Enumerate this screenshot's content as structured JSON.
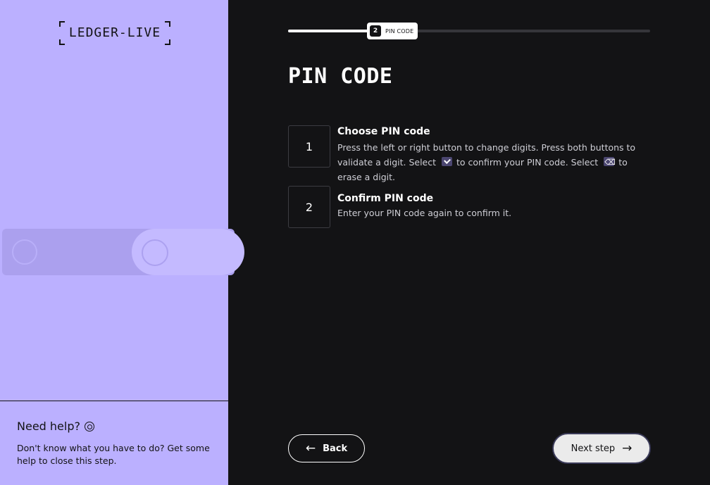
{
  "left_panel": {
    "logo_text": "LEDGER-LIVE",
    "help": {
      "title": "Need help?",
      "icon": "lifebuoy-icon",
      "text": "Don't know what you have to do? Get some help to close this step."
    },
    "background_color": "#bbb0ff"
  },
  "progress": {
    "current_step_number": "2",
    "current_step_label": "PIN CODE",
    "fill_fraction": 0.23
  },
  "main": {
    "title": "PIN CODE",
    "steps": [
      {
        "number": "1",
        "title": "Choose PIN code",
        "desc_part1": "Press the left or right button to change digits. Press both buttons to validate a digit. Select",
        "desc_part2": "to confirm your PIN code. Select",
        "desc_part3": "to erase a digit.",
        "icons": [
          "check-icon",
          "erase-icon"
        ]
      },
      {
        "number": "2",
        "title": "Confirm PIN code",
        "desc": "Enter your PIN code again to confirm it."
      }
    ]
  },
  "footer": {
    "back_label": "Back",
    "next_label": "Next step",
    "back_icon": "arrow-left-icon",
    "next_icon": "arrow-right-icon"
  },
  "colors": {
    "dark_bg": "#131315",
    "accent": "#bbb0ff"
  }
}
